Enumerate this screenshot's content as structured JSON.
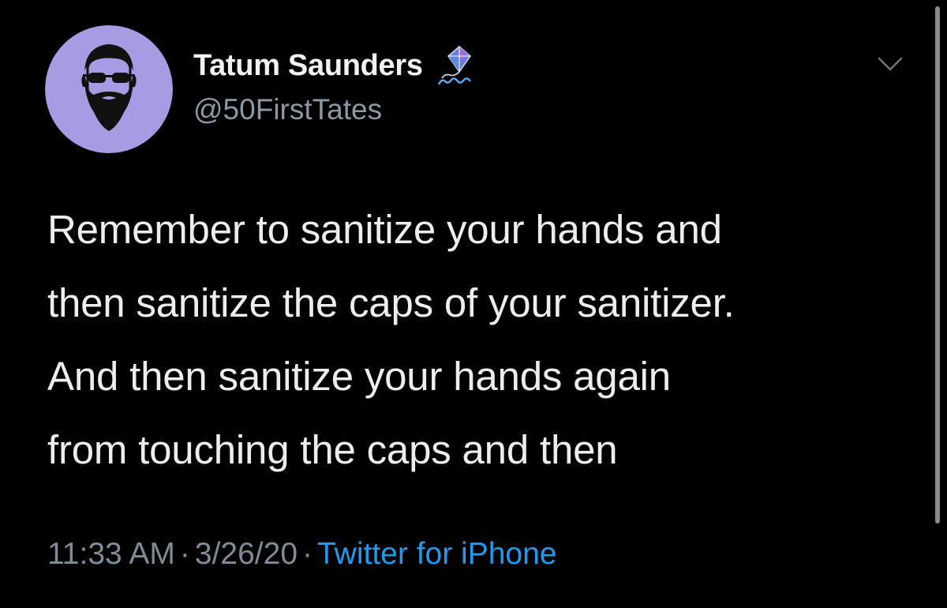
{
  "user": {
    "display_name": "Tatum Saunders",
    "handle": "@50FirstTates",
    "avatar_icon": "bearded-man-avatar-icon",
    "avatar_bg": "#a99be3",
    "badge_icon": "kite-icon"
  },
  "tweet": {
    "lines": [
      "Remember to sanitize your hands and",
      "then sanitize the caps of your sanitizer.",
      "And then sanitize your hands again",
      "from touching the caps and then"
    ]
  },
  "meta": {
    "time": "11:33 AM",
    "date": "3/26/20",
    "separator": "·",
    "source": "Twitter for iPhone",
    "source_color": "#1d9bf0"
  },
  "controls": {
    "more_icon": "chevron-down-icon"
  }
}
